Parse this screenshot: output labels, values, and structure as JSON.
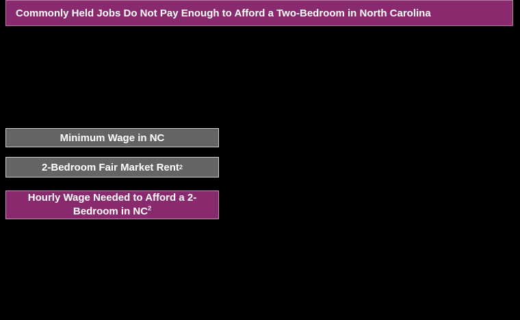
{
  "title": "Commonly Held Jobs Do Not Pay Enough to Afford a Two-Bedroom in North Carolina",
  "labels": {
    "min_wage": "Minimum Wage in NC",
    "fmr": "2-Bedroom Fair Market Rent",
    "fmr_sup": "2",
    "hourly": "Hourly Wage Needed to Afford a 2-Bedroom in NC",
    "hourly_sup": "2"
  },
  "colors": {
    "title_bg": "#8a2a6e",
    "gray_box": "#646464",
    "purple_box": "#8a2a6e",
    "background": "#000000"
  }
}
